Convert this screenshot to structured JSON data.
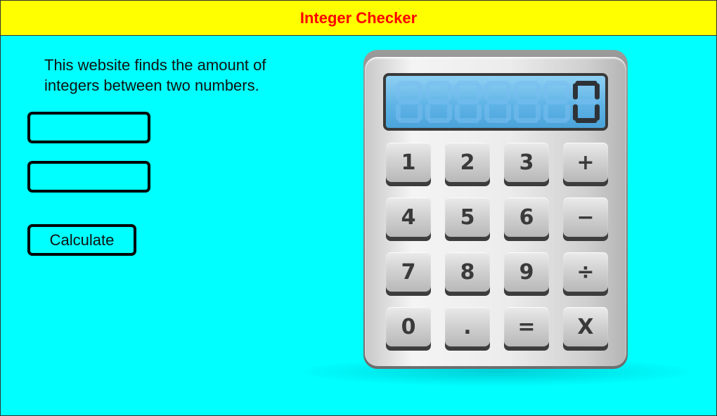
{
  "header": {
    "title": "Integer Checker"
  },
  "intro": {
    "text": "This website finds the amount of integers between two numbers."
  },
  "inputs": {
    "first_value": "",
    "second_value": ""
  },
  "calculate": {
    "label": "Calculate"
  },
  "calculator": {
    "display_value": "0",
    "keys": [
      "1",
      "2",
      "3",
      "+",
      "4",
      "5",
      "6",
      "−",
      "7",
      "8",
      "9",
      "÷",
      "0",
      ".",
      "=",
      "X"
    ]
  },
  "colors": {
    "page_bg": "#00ffff",
    "header_bg": "#ffff00",
    "header_text": "#ff0000",
    "display_bg": "#5fb4e6"
  }
}
